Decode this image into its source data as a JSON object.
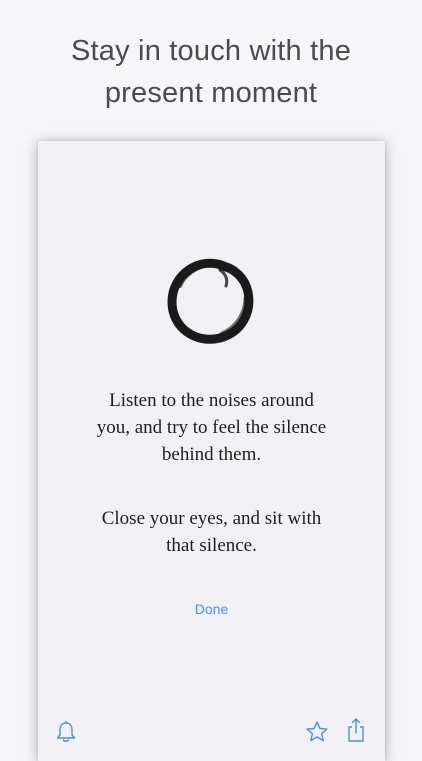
{
  "headline": {
    "line1": "Stay in touch with the",
    "line2": "present moment"
  },
  "card": {
    "logo_icon": "enso-circle-icon",
    "quote1": [
      "Listen to the noises around",
      "you, and try to feel the silence",
      "behind them."
    ],
    "quote2": [
      "Close your eyes, and sit with",
      "that silence."
    ],
    "done_label": "Done"
  },
  "toolbar": {
    "left_icon": "bell-icon",
    "right_icons": [
      "star-icon",
      "share-icon"
    ]
  },
  "colors": {
    "background": "#f6f6f8",
    "card": "#f1f0f5",
    "accent": "#4a90d9",
    "headline": "#4b4b4e",
    "text": "#1d1d1f"
  }
}
